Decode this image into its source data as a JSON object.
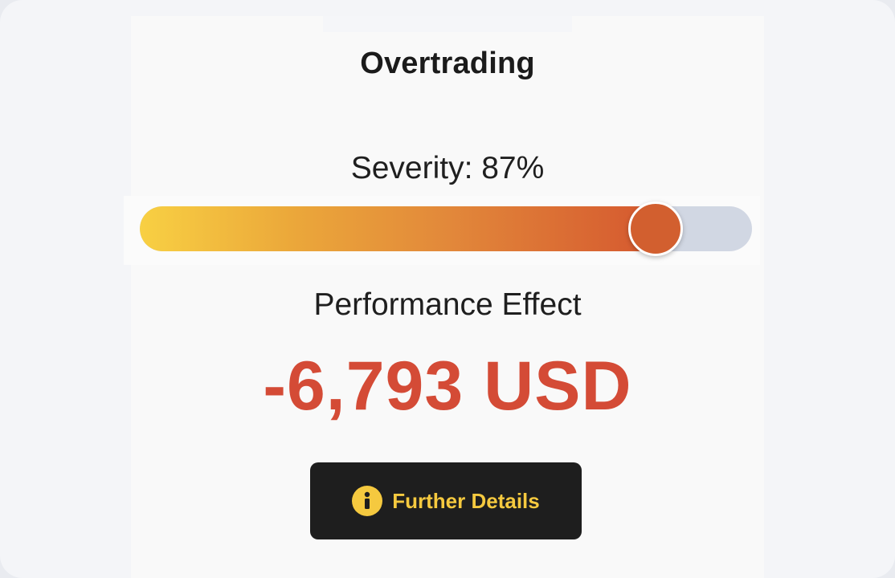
{
  "widget": {
    "title": "Overtrading",
    "severity": {
      "label": "Severity: 87%",
      "value_fraction": 0.87
    },
    "performance": {
      "label": "Performance Effect",
      "value": "-6,793 USD"
    },
    "details_button": {
      "label": "Further Details",
      "icon": "info-icon"
    }
  },
  "colors": {
    "accent_yellow": "#f5c93f",
    "negative_red": "#d44b36",
    "thumb_orange": "#d25f2f",
    "track_gray": "#d1d7e3",
    "button_bg": "#1e1e1e"
  }
}
